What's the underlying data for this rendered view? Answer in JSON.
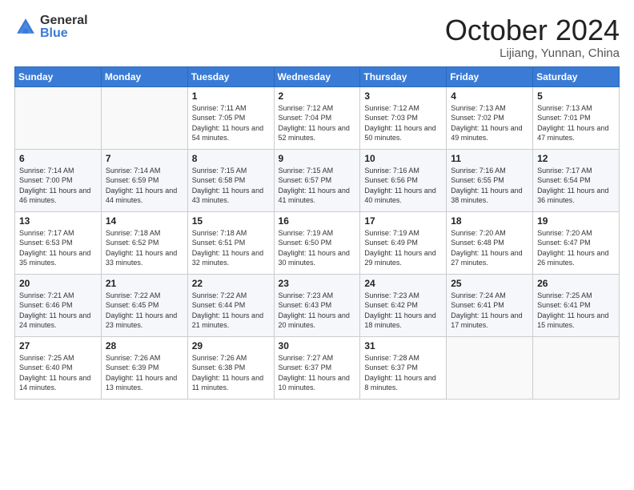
{
  "header": {
    "logo_general": "General",
    "logo_blue": "Blue",
    "month_title": "October 2024",
    "location": "Lijiang, Yunnan, China"
  },
  "weekdays": [
    "Sunday",
    "Monday",
    "Tuesday",
    "Wednesday",
    "Thursday",
    "Friday",
    "Saturday"
  ],
  "weeks": [
    [
      {
        "day": "",
        "info": ""
      },
      {
        "day": "",
        "info": ""
      },
      {
        "day": "1",
        "info": "Sunrise: 7:11 AM\nSunset: 7:05 PM\nDaylight: 11 hours and 54 minutes."
      },
      {
        "day": "2",
        "info": "Sunrise: 7:12 AM\nSunset: 7:04 PM\nDaylight: 11 hours and 52 minutes."
      },
      {
        "day": "3",
        "info": "Sunrise: 7:12 AM\nSunset: 7:03 PM\nDaylight: 11 hours and 50 minutes."
      },
      {
        "day": "4",
        "info": "Sunrise: 7:13 AM\nSunset: 7:02 PM\nDaylight: 11 hours and 49 minutes."
      },
      {
        "day": "5",
        "info": "Sunrise: 7:13 AM\nSunset: 7:01 PM\nDaylight: 11 hours and 47 minutes."
      }
    ],
    [
      {
        "day": "6",
        "info": "Sunrise: 7:14 AM\nSunset: 7:00 PM\nDaylight: 11 hours and 46 minutes."
      },
      {
        "day": "7",
        "info": "Sunrise: 7:14 AM\nSunset: 6:59 PM\nDaylight: 11 hours and 44 minutes."
      },
      {
        "day": "8",
        "info": "Sunrise: 7:15 AM\nSunset: 6:58 PM\nDaylight: 11 hours and 43 minutes."
      },
      {
        "day": "9",
        "info": "Sunrise: 7:15 AM\nSunset: 6:57 PM\nDaylight: 11 hours and 41 minutes."
      },
      {
        "day": "10",
        "info": "Sunrise: 7:16 AM\nSunset: 6:56 PM\nDaylight: 11 hours and 40 minutes."
      },
      {
        "day": "11",
        "info": "Sunrise: 7:16 AM\nSunset: 6:55 PM\nDaylight: 11 hours and 38 minutes."
      },
      {
        "day": "12",
        "info": "Sunrise: 7:17 AM\nSunset: 6:54 PM\nDaylight: 11 hours and 36 minutes."
      }
    ],
    [
      {
        "day": "13",
        "info": "Sunrise: 7:17 AM\nSunset: 6:53 PM\nDaylight: 11 hours and 35 minutes."
      },
      {
        "day": "14",
        "info": "Sunrise: 7:18 AM\nSunset: 6:52 PM\nDaylight: 11 hours and 33 minutes."
      },
      {
        "day": "15",
        "info": "Sunrise: 7:18 AM\nSunset: 6:51 PM\nDaylight: 11 hours and 32 minutes."
      },
      {
        "day": "16",
        "info": "Sunrise: 7:19 AM\nSunset: 6:50 PM\nDaylight: 11 hours and 30 minutes."
      },
      {
        "day": "17",
        "info": "Sunrise: 7:19 AM\nSunset: 6:49 PM\nDaylight: 11 hours and 29 minutes."
      },
      {
        "day": "18",
        "info": "Sunrise: 7:20 AM\nSunset: 6:48 PM\nDaylight: 11 hours and 27 minutes."
      },
      {
        "day": "19",
        "info": "Sunrise: 7:20 AM\nSunset: 6:47 PM\nDaylight: 11 hours and 26 minutes."
      }
    ],
    [
      {
        "day": "20",
        "info": "Sunrise: 7:21 AM\nSunset: 6:46 PM\nDaylight: 11 hours and 24 minutes."
      },
      {
        "day": "21",
        "info": "Sunrise: 7:22 AM\nSunset: 6:45 PM\nDaylight: 11 hours and 23 minutes."
      },
      {
        "day": "22",
        "info": "Sunrise: 7:22 AM\nSunset: 6:44 PM\nDaylight: 11 hours and 21 minutes."
      },
      {
        "day": "23",
        "info": "Sunrise: 7:23 AM\nSunset: 6:43 PM\nDaylight: 11 hours and 20 minutes."
      },
      {
        "day": "24",
        "info": "Sunrise: 7:23 AM\nSunset: 6:42 PM\nDaylight: 11 hours and 18 minutes."
      },
      {
        "day": "25",
        "info": "Sunrise: 7:24 AM\nSunset: 6:41 PM\nDaylight: 11 hours and 17 minutes."
      },
      {
        "day": "26",
        "info": "Sunrise: 7:25 AM\nSunset: 6:41 PM\nDaylight: 11 hours and 15 minutes."
      }
    ],
    [
      {
        "day": "27",
        "info": "Sunrise: 7:25 AM\nSunset: 6:40 PM\nDaylight: 11 hours and 14 minutes."
      },
      {
        "day": "28",
        "info": "Sunrise: 7:26 AM\nSunset: 6:39 PM\nDaylight: 11 hours and 13 minutes."
      },
      {
        "day": "29",
        "info": "Sunrise: 7:26 AM\nSunset: 6:38 PM\nDaylight: 11 hours and 11 minutes."
      },
      {
        "day": "30",
        "info": "Sunrise: 7:27 AM\nSunset: 6:37 PM\nDaylight: 11 hours and 10 minutes."
      },
      {
        "day": "31",
        "info": "Sunrise: 7:28 AM\nSunset: 6:37 PM\nDaylight: 11 hours and 8 minutes."
      },
      {
        "day": "",
        "info": ""
      },
      {
        "day": "",
        "info": ""
      }
    ]
  ]
}
